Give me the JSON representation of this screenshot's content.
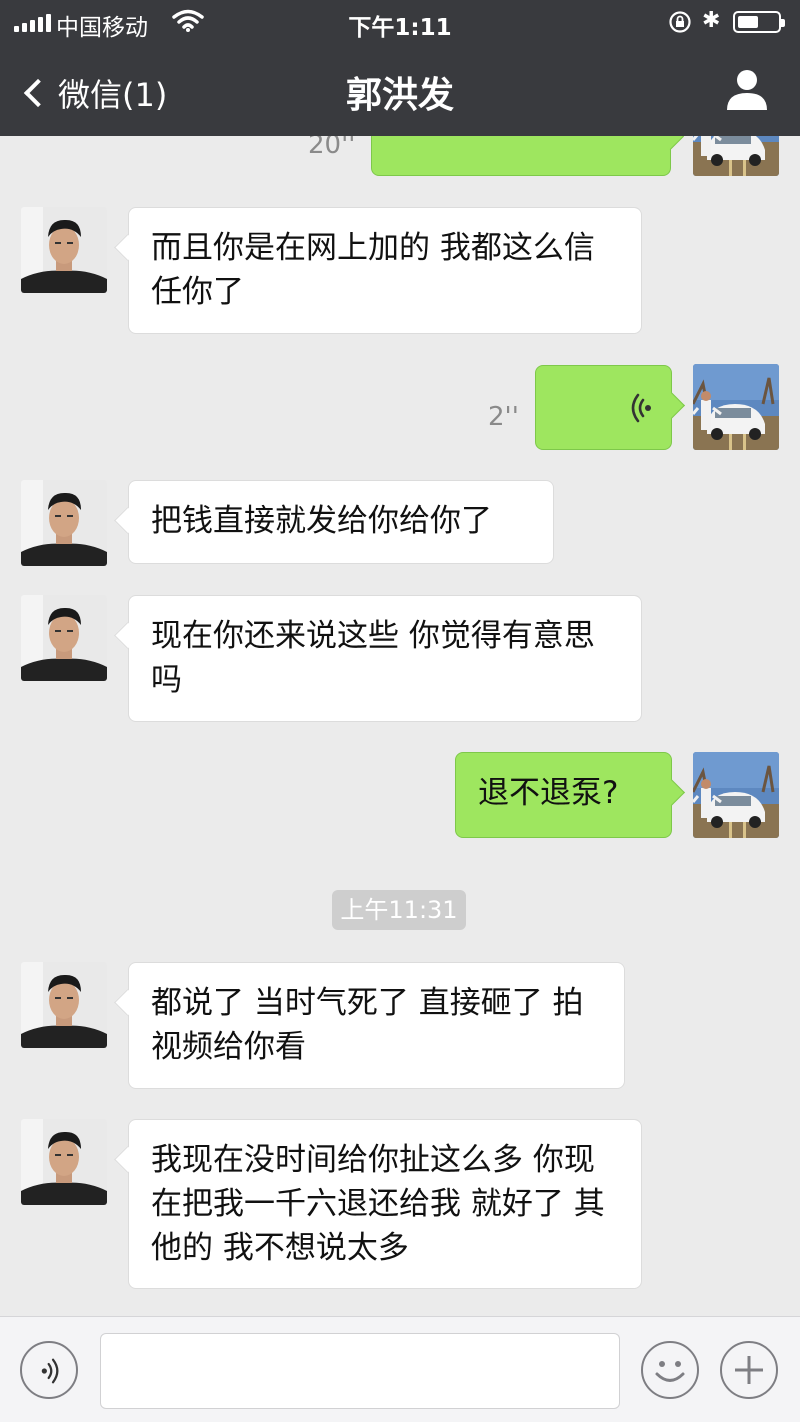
{
  "status_bar": {
    "carrier": "中国移动",
    "time": "下午1:11"
  },
  "nav": {
    "back_label": "微信(1)",
    "title": "郭洪发"
  },
  "messages": [
    {
      "side": "out",
      "type": "voice",
      "duration": "20''"
    },
    {
      "side": "in",
      "type": "text",
      "text": "而且你是在网上加的  我都这么信任你了"
    },
    {
      "side": "out",
      "type": "voice",
      "duration": "2''"
    },
    {
      "side": "in",
      "type": "text",
      "text": "把钱直接就发给你给你了"
    },
    {
      "side": "in",
      "type": "text",
      "text": "现在你还来说这些  你觉得有意思吗"
    },
    {
      "side": "out",
      "type": "text",
      "text": "退不退泵?"
    },
    {
      "type": "timestamp",
      "text": "上午11:31"
    },
    {
      "side": "in",
      "type": "text",
      "text": "都说了 当时气死了 直接砸了 拍视频给你看"
    },
    {
      "side": "in",
      "type": "text",
      "text": "我现在没时间给你扯这么多  你现在把我一千六退还给我 就好了  其他的 我不想说太多"
    }
  ],
  "input_bar": {
    "placeholder": ""
  },
  "colors": {
    "nav_bg": "#393a3e",
    "chat_bg": "#ebebeb",
    "outgoing_bubble": "#9ee65f",
    "incoming_bubble": "#ffffff"
  }
}
